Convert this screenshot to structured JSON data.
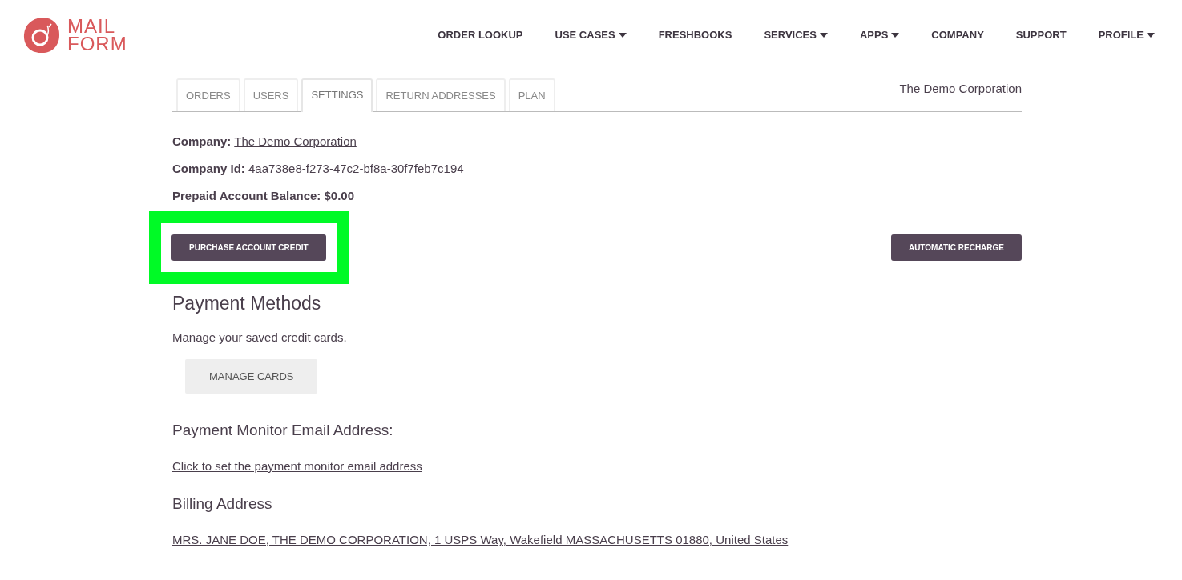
{
  "logo": {
    "line1": "MAIL",
    "line2": "FORM"
  },
  "nav": [
    {
      "label": "ORDER LOOKUP",
      "dropdown": false
    },
    {
      "label": "USE CASES",
      "dropdown": true
    },
    {
      "label": "FRESHBOOKS",
      "dropdown": false
    },
    {
      "label": "SERVICES",
      "dropdown": true
    },
    {
      "label": "APPS",
      "dropdown": true
    },
    {
      "label": "COMPANY",
      "dropdown": false
    },
    {
      "label": "SUPPORT",
      "dropdown": false
    },
    {
      "label": "PROFILE",
      "dropdown": true
    }
  ],
  "tabs": [
    {
      "label": "ORDERS",
      "selected": false
    },
    {
      "label": "USERS",
      "selected": false
    },
    {
      "label": "SETTINGS",
      "selected": true
    },
    {
      "label": "RETURN ADDRESSES",
      "selected": false
    },
    {
      "label": "PLAN",
      "selected": false
    }
  ],
  "company_name": "The Demo Corporation",
  "fields": [
    {
      "label": "Company:",
      "value": "The Demo Corporation",
      "link": true
    },
    {
      "label": "Company Id:",
      "value": "4aa738e8-f273-47c2-bf8a-30f7feb7c194",
      "link": false
    },
    {
      "label": "Prepaid Account Balance:",
      "value": "$0.00",
      "link": false,
      "bold_value": true
    }
  ],
  "purchase_button": {
    "label": "PURCHASE ACCOUNT CREDIT",
    "highlighted": true
  },
  "recharge_button": {
    "label": "AUTOMATIC RECHARGE"
  },
  "payment_methods": {
    "heading": "Payment Methods",
    "text": "Manage your saved credit cards.",
    "button": "MANAGE CARDS"
  },
  "payment_monitor": {
    "heading": "Payment Monitor Email Address:",
    "link": "Click to set the payment monitor email address"
  },
  "billing": {
    "heading": "Billing Address",
    "link": "MRS. JANE DOE, THE DEMO CORPORATION, 1 USPS Way, Wakefield MASSACHUSETTS 01880, United States"
  }
}
